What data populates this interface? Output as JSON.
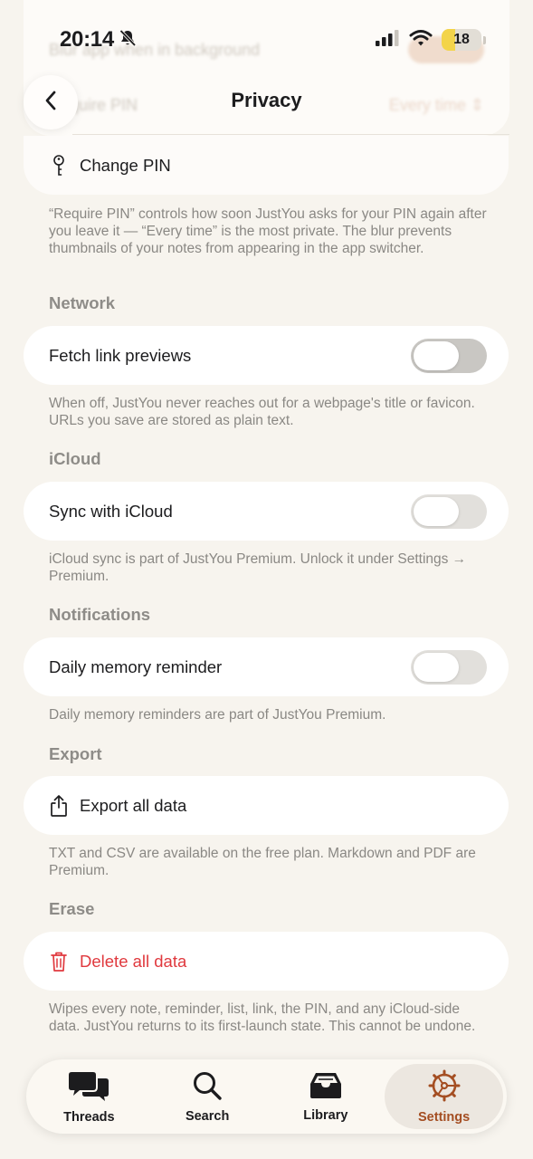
{
  "status_bar": {
    "time": "20:14",
    "battery": "18"
  },
  "behind": {
    "row1_label": "Blur app when in background",
    "row2_label": "Require PIN",
    "row2_value": "Every time ⇕"
  },
  "nav": {
    "title": "Privacy"
  },
  "security": {
    "change_pin_label": "Change PIN",
    "footnote": "“Require PIN” controls how soon JustYou asks for your PIN again after you leave it — “Every time” is the most private. The blur prevents thumbnails of your notes from appearing in the app switcher."
  },
  "network": {
    "header": "Network",
    "fetch_previews_label": "Fetch link previews",
    "fetch_previews_on": false,
    "footnote": "When off, JustYou never reaches out for a webpage's title or favicon. URLs you save are stored as plain text."
  },
  "icloud": {
    "header": "iCloud",
    "sync_label": "Sync with iCloud",
    "sync_on": false,
    "footnote": "iCloud sync is part of JustYou Premium. Unlock it under Settings → Premium."
  },
  "notifications": {
    "header": "Notifications",
    "reminder_label": "Daily memory reminder",
    "reminder_on": false,
    "footnote": "Daily memory reminders are part of JustYou Premium."
  },
  "export": {
    "header": "Export",
    "export_label": "Export all data",
    "footnote": "TXT and CSV are available on the free plan. Markdown and PDF are Premium."
  },
  "erase": {
    "header": "Erase",
    "delete_label": "Delete all data",
    "footnote": "Wipes every note, reminder, list, link, the PIN, and any iCloud-side data. JustYou returns to its first-launch state. This cannot be undone."
  },
  "tabs": [
    {
      "label": "Threads",
      "icon": "speech-bubbles-icon",
      "active": false
    },
    {
      "label": "Search",
      "icon": "magnifier-icon",
      "active": false
    },
    {
      "label": "Library",
      "icon": "tray-icon",
      "active": false
    },
    {
      "label": "Settings",
      "icon": "gear-icon",
      "active": true
    }
  ],
  "colors": {
    "accent": "#a44e22",
    "danger": "#e0393e",
    "background": "#f7f4ee"
  }
}
